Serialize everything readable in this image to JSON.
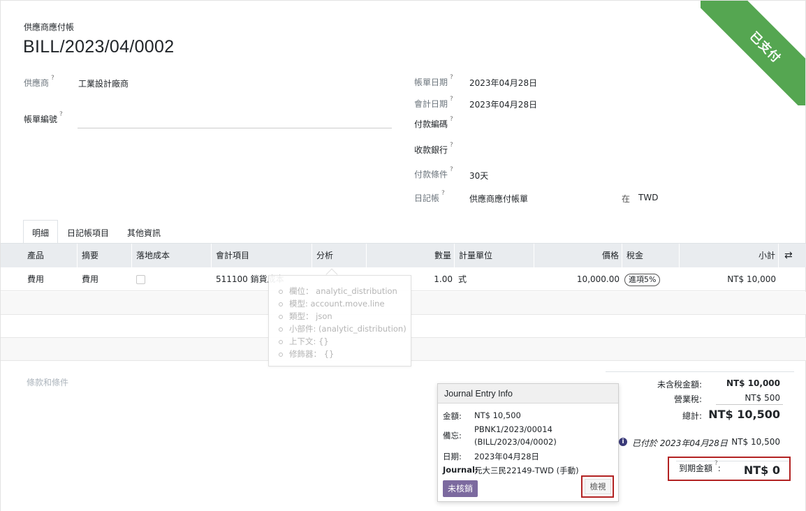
{
  "ribbon": "已支付",
  "header": {
    "doc_type": "供應商應付帳",
    "title": "BILL/2023/04/0002"
  },
  "fields": {
    "vendor_label": "供應商",
    "vendor_value": "工業設計廠商",
    "bill_ref_label": "帳單編號",
    "bill_date_label": "帳單日期",
    "bill_date_value": "2023年04月28日",
    "acc_date_label": "會計日期",
    "acc_date_value": "2023年04月28日",
    "payment_ref_label": "付款編碼",
    "bank_label": "收款銀行",
    "terms_label": "付款條件",
    "terms_value": "30天",
    "journal_label": "日記帳",
    "journal_value": "供應商應付帳單",
    "currency_in": "在",
    "currency_value": "TWD",
    "help_mark": "?"
  },
  "tabs": [
    {
      "label": "明細"
    },
    {
      "label": "日記帳項目"
    },
    {
      "label": "其他資訊"
    }
  ],
  "table": {
    "headers": {
      "product": "產品",
      "desc": "摘要",
      "landed": "落地成本",
      "account": "會計項目",
      "analytic": "分析",
      "qty": "數量",
      "uom": "計量單位",
      "price": "價格",
      "tax": "稅金",
      "subtotal": "小計"
    },
    "rows": [
      {
        "product": "費用",
        "desc": "費用",
        "account": "511100 銷貨成本",
        "qty": "1.00",
        "uom": "式",
        "price": "10,000.00",
        "tax": "進項5%",
        "subtotal": "NT$ 10,000"
      }
    ]
  },
  "tooltip": {
    "lines": [
      "欄位： analytic_distribution",
      "模型: account.move.line",
      "類型： json",
      "小部件: (analytic_distribution)",
      "上下文: {}",
      "修飾器： {}"
    ]
  },
  "terms_placeholder": "條款和條件",
  "totals": {
    "untaxed_label": "未含稅金額:",
    "untaxed_value": "NT$ 10,000",
    "tax_label": "營業稅:",
    "tax_value": "NT$ 500",
    "total_label": "總計:",
    "total_value": "NT$ 10,500",
    "paid_text": "已付於 2023年04月28日",
    "paid_value": "NT$ 10,500",
    "due_label": "到期金額",
    "due_value": "NT$ 0"
  },
  "popover": {
    "title": "Journal Entry Info",
    "amount_label": "金額:",
    "amount_value": "NT$ 10,500",
    "memo_label": "備忘:",
    "memo_line1": "PBNK1/2023/00014",
    "memo_line2": "(BILL/2023/04/0002)",
    "date_label": "日期:",
    "date_value": "2023年04月28日",
    "journal_label": "Journal:",
    "journal_value": "元大三民22149-TWD (手動)",
    "unreconcile_label": "未核銷",
    "view_label": "檢視"
  }
}
